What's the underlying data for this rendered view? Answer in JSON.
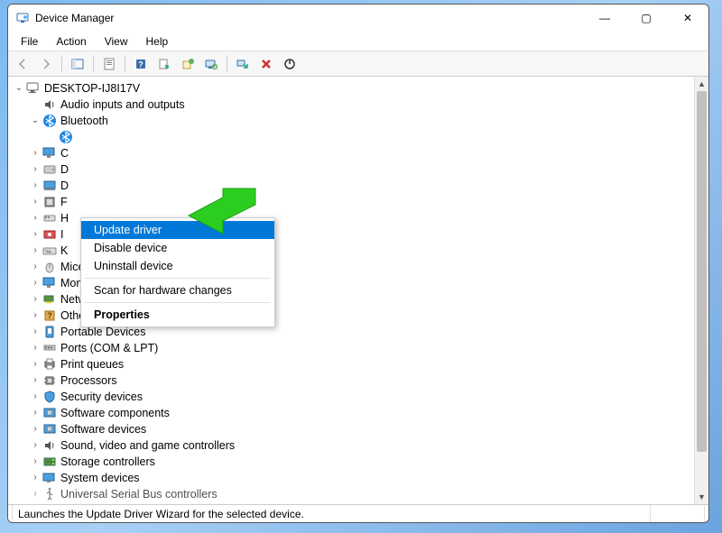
{
  "window": {
    "title": "Device Manager",
    "controls": {
      "min": "—",
      "max": "▢",
      "close": "✕"
    }
  },
  "menu": {
    "file": "File",
    "action": "Action",
    "view": "View",
    "help": "Help"
  },
  "tree": {
    "root": "DESKTOP-IJ8I17V",
    "bluetooth_child": "Bluetooth",
    "categories": [
      "Audio inputs and outputs",
      "Bluetooth",
      "C",
      "D",
      "D",
      "F",
      "H",
      "I",
      "K",
      "Mice and other pointing devices",
      "Monitors",
      "Network adapters",
      "Other devices",
      "Portable Devices",
      "Ports (COM & LPT)",
      "Print queues",
      "Processors",
      "Security devices",
      "Software components",
      "Software devices",
      "Sound, video and game controllers",
      "Storage controllers",
      "System devices",
      "Universal Serial Bus controllers"
    ]
  },
  "context_menu": {
    "update": "Update driver",
    "disable": "Disable device",
    "uninstall": "Uninstall device",
    "scan": "Scan for hardware changes",
    "properties": "Properties"
  },
  "statusbar": {
    "text": "Launches the Update Driver Wizard for the selected device."
  },
  "colors": {
    "highlight": "#0078d7",
    "arrow": "#2bce1f"
  }
}
